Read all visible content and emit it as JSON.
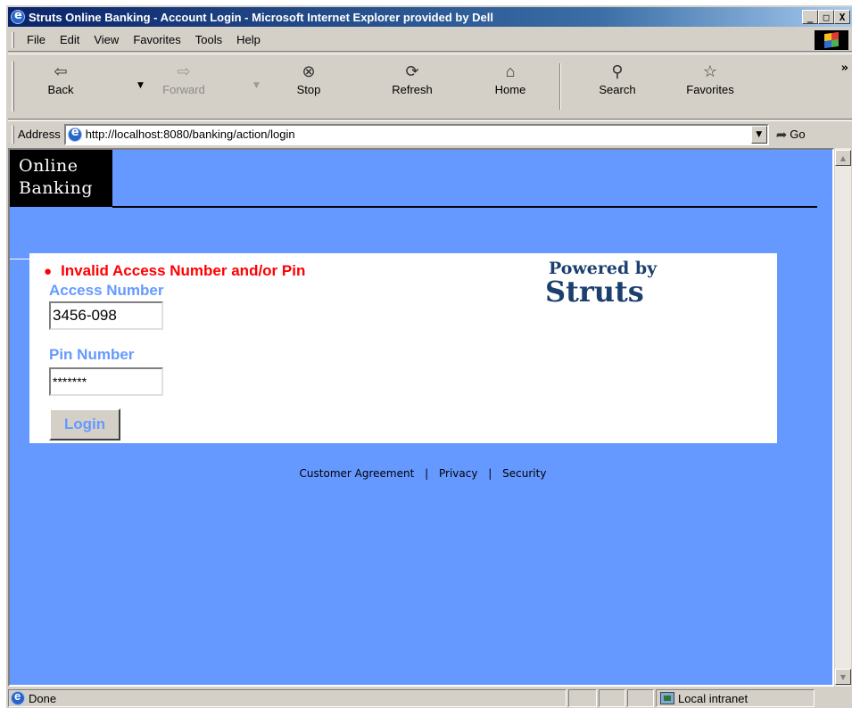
{
  "window": {
    "title": "Struts Online Banking - Account Login - Microsoft Internet Explorer provided by Dell",
    "minimize": "_",
    "maximize": "□",
    "close": "X"
  },
  "menu": {
    "items": [
      "File",
      "Edit",
      "View",
      "Favorites",
      "Tools",
      "Help"
    ]
  },
  "toolbar": {
    "back": "Back",
    "forward": "Forward",
    "stop": "Stop",
    "refresh": "Refresh",
    "home": "Home",
    "search": "Search",
    "favorites": "Favorites",
    "more": "»"
  },
  "address": {
    "label": "Address",
    "url": "http://localhost:8080/banking/action/login",
    "go": "Go"
  },
  "page": {
    "logo_line1": "Online",
    "logo_line2": "Banking",
    "error": "Invalid Access Number and/or Pin",
    "access_label": "Access Number",
    "access_value": "3456-098",
    "pin_label": "Pin Number",
    "pin_value": "*******",
    "login_button": "Login",
    "powered_by": "Powered by",
    "struts": "Struts",
    "footer": {
      "customer_agreement": "Customer Agreement",
      "privacy": "Privacy",
      "security": "Security",
      "separator": "|"
    }
  },
  "status": {
    "text": "Done",
    "zone": "Local intranet"
  },
  "colors": {
    "page_background": "#6699ff",
    "error": "#ff0000",
    "label": "#6699ff",
    "struts_brand": "#1c3f6e"
  }
}
